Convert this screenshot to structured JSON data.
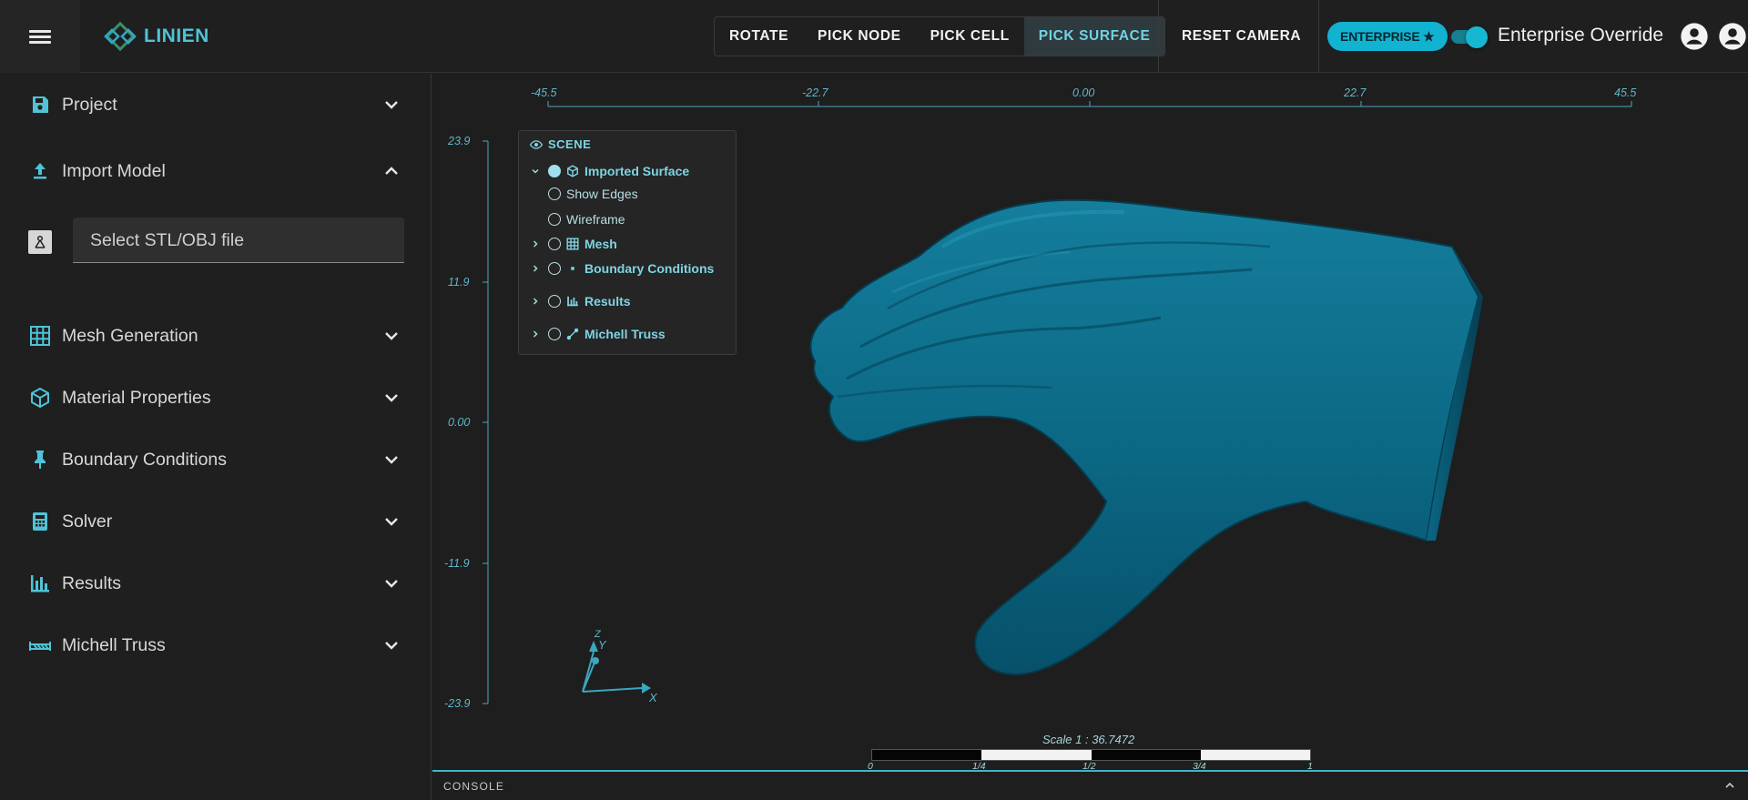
{
  "app": {
    "brand": "LINIEN"
  },
  "toolbar": {
    "modes": [
      "ROTATE",
      "PICK NODE",
      "PICK CELL",
      "PICK SURFACE"
    ],
    "active_mode": "PICK SURFACE",
    "reset_camera": "RESET CAMERA",
    "enterprise_badge": "ENTERPRISE ★",
    "enterprise_override_label": "Enterprise Override",
    "enterprise_override_on": true
  },
  "sidebar": {
    "items": [
      {
        "label": "Project",
        "icon": "save-icon",
        "expanded": false
      },
      {
        "label": "Import Model",
        "icon": "upload-icon",
        "expanded": true
      },
      {
        "label": "Mesh Generation",
        "icon": "grid-icon",
        "expanded": false
      },
      {
        "label": "Material Properties",
        "icon": "cube-icon",
        "expanded": false
      },
      {
        "label": "Boundary Conditions",
        "icon": "pin-icon",
        "expanded": false
      },
      {
        "label": "Solver",
        "icon": "calculator-icon",
        "expanded": false
      },
      {
        "label": "Results",
        "icon": "bar-chart-icon",
        "expanded": false
      },
      {
        "label": "Michell Truss",
        "icon": "truss-icon",
        "expanded": false
      }
    ],
    "import": {
      "file_placeholder": "Select STL/OBJ file"
    }
  },
  "viewport": {
    "x_ticks": [
      "-45.5",
      "-22.7",
      "0.00",
      "22.7",
      "45.5"
    ],
    "y_ticks": [
      "23.9",
      "11.9",
      "0.00",
      "-11.9",
      "-23.9"
    ],
    "scene": {
      "title": "SCENE",
      "items": [
        {
          "label": "Imported Surface",
          "icon": "cube-icon",
          "expandable": true,
          "expanded": true,
          "checked": true,
          "bold": true
        },
        {
          "label": "Show Edges",
          "expandable": false,
          "checked": false,
          "bold": false
        },
        {
          "label": "Wireframe",
          "expandable": false,
          "checked": false,
          "bold": false
        },
        {
          "label": "Mesh",
          "icon": "grid-icon",
          "expandable": true,
          "expanded": false,
          "checked": false,
          "bold": true
        },
        {
          "label": "Boundary Conditions",
          "icon": "dot-icon",
          "expandable": true,
          "expanded": false,
          "checked": false,
          "bold": true
        },
        {
          "label": "Results",
          "icon": "bar-chart-icon",
          "expandable": true,
          "expanded": false,
          "checked": false,
          "bold": true
        },
        {
          "label": "Michell Truss",
          "icon": "truss-icon",
          "expandable": true,
          "expanded": false,
          "checked": false,
          "bold": true
        }
      ]
    },
    "axes_triad": {
      "x": "X",
      "y": "Y",
      "z": "Z"
    },
    "scale": {
      "label": "Scale 1 : 36.7472",
      "ticks": [
        "0",
        "1/4",
        "1/2",
        "3/4",
        "1"
      ]
    },
    "model_color": "#0b6a85"
  },
  "console": {
    "label": "CONSOLE"
  },
  "colors": {
    "accent": "#4fc3d7",
    "badge": "#12b3d1",
    "background": "#1e1e1e"
  }
}
